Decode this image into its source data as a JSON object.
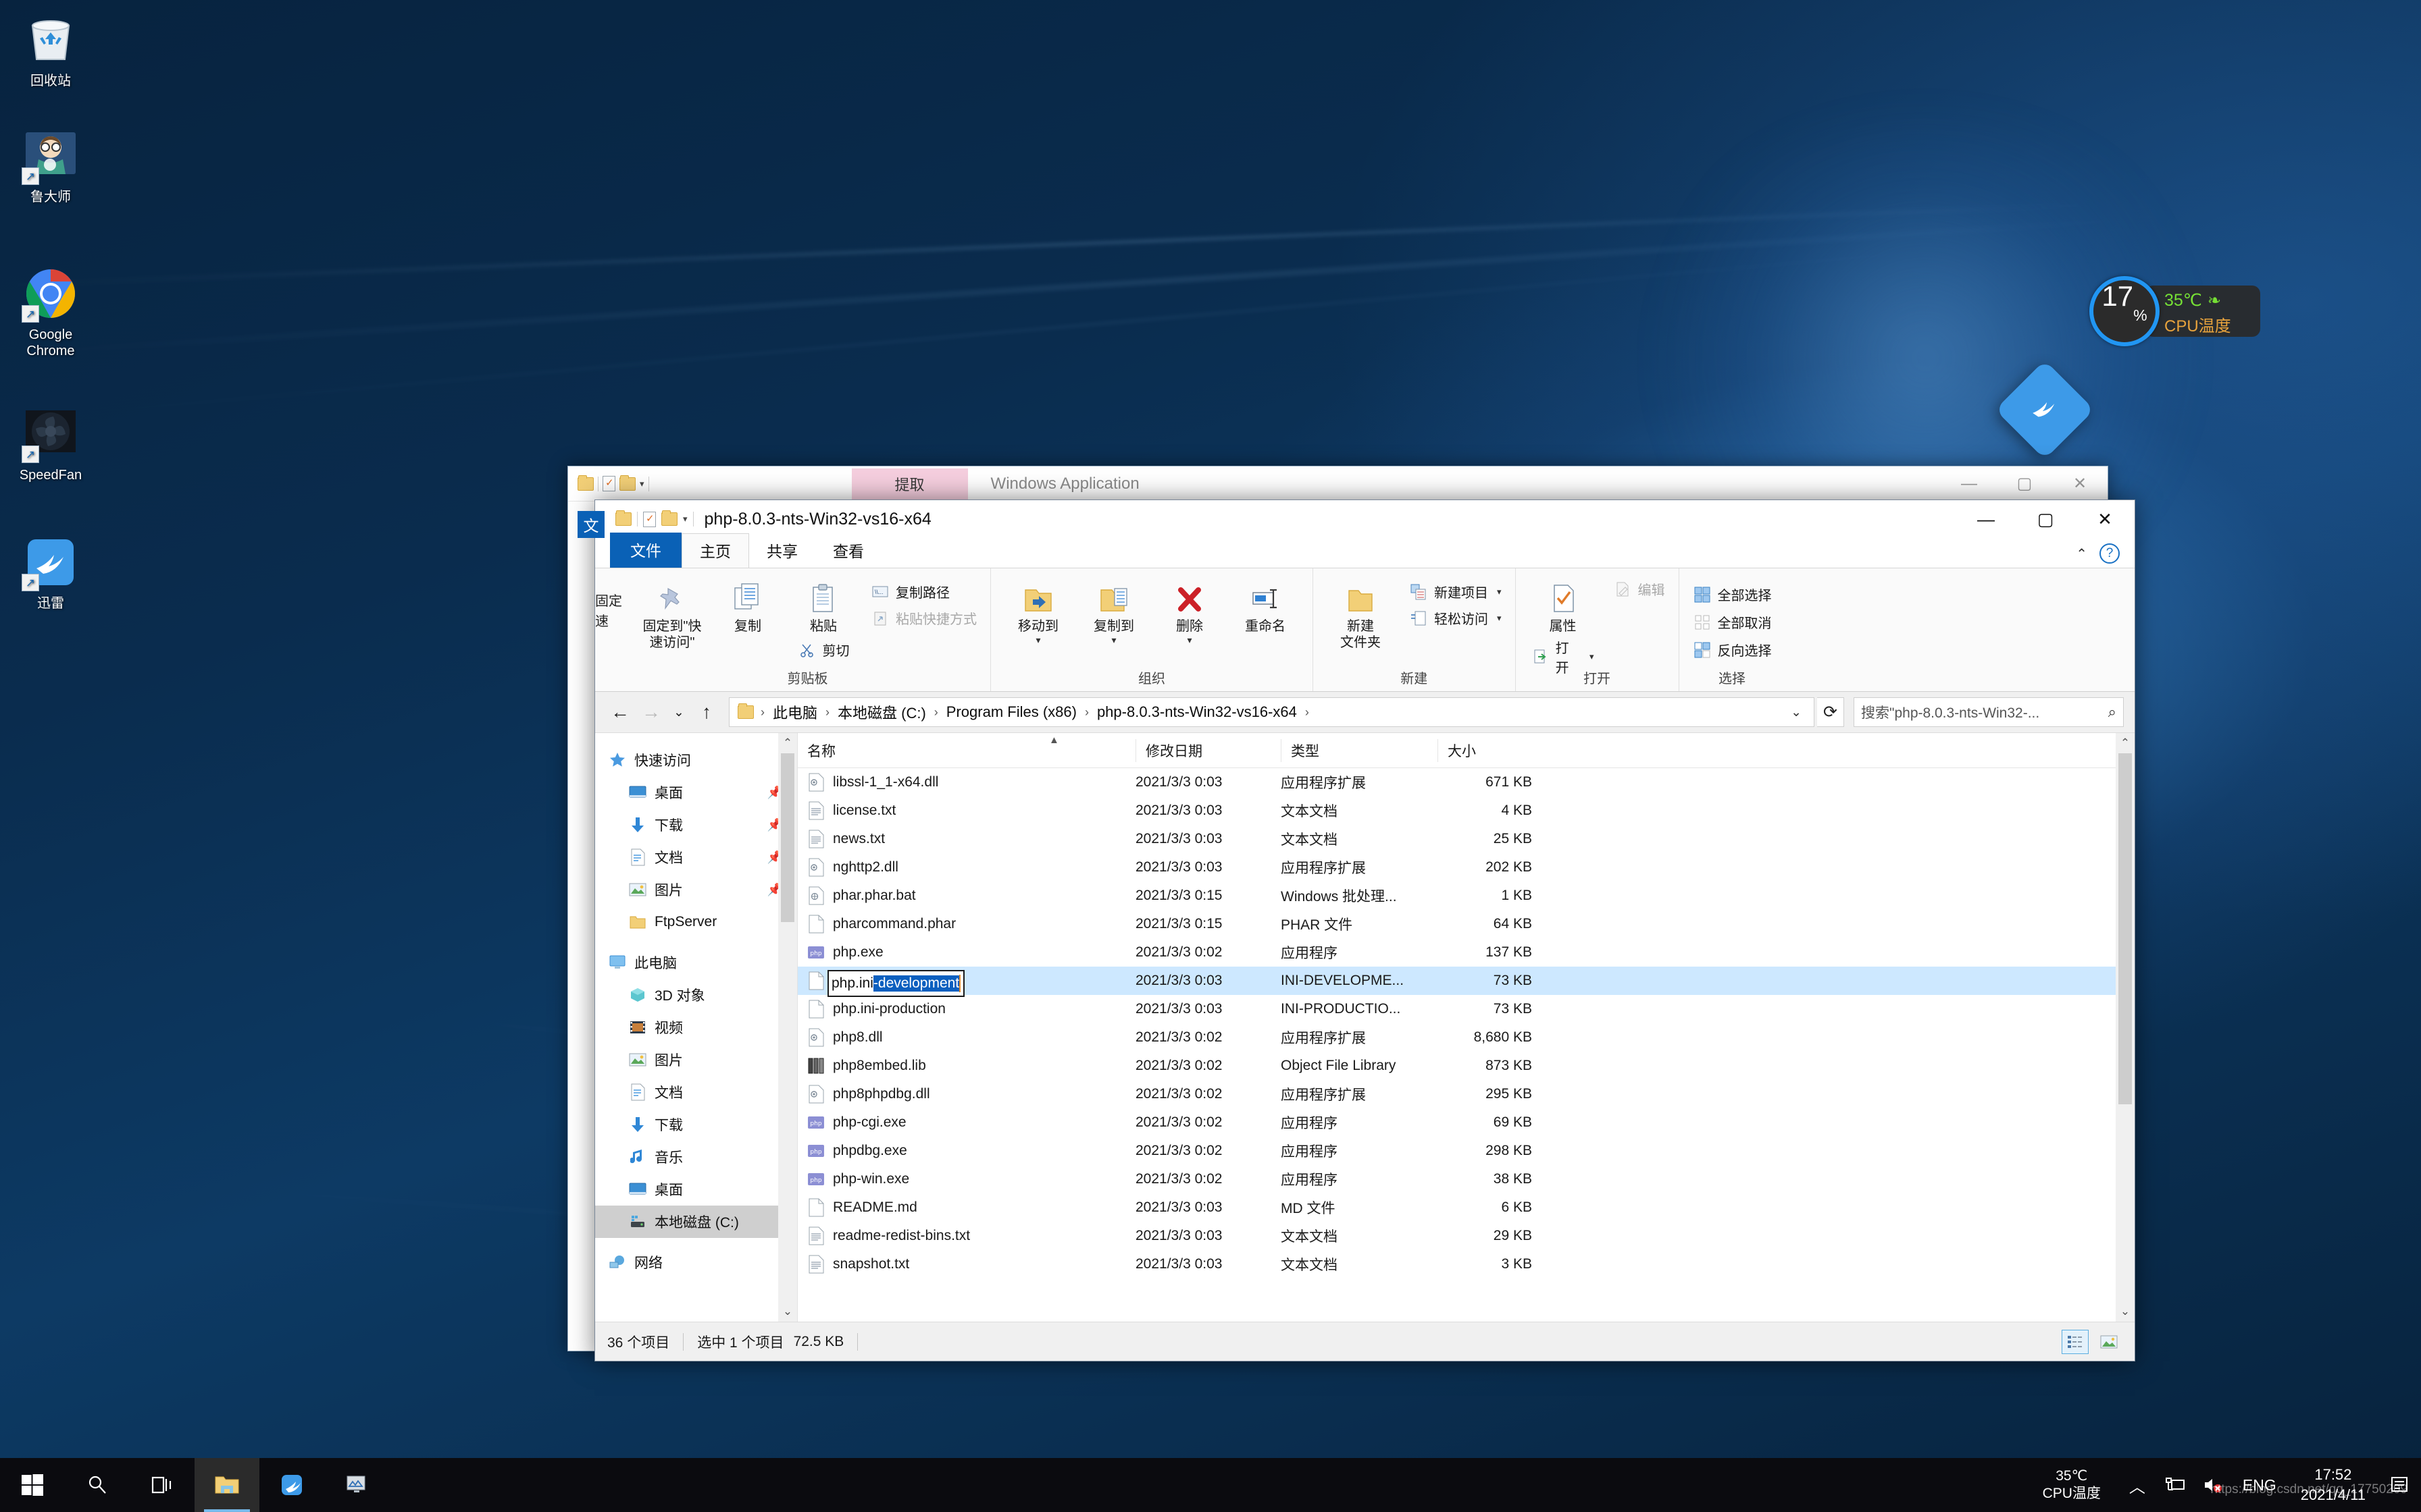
{
  "desktop": {
    "icons": [
      {
        "label": "回收站",
        "icon": "recycle-bin-icon",
        "shortcut": false
      },
      {
        "label": "鲁大师",
        "icon": "ludashi-icon",
        "shortcut": true
      },
      {
        "label": "Google\nChrome",
        "icon": "chrome-icon",
        "shortcut": true
      },
      {
        "label": "SpeedFan",
        "icon": "speedfan-icon",
        "shortcut": true
      },
      {
        "label": "迅雷",
        "icon": "xunlei-icon",
        "shortcut": true
      }
    ]
  },
  "cpu_widget": {
    "usage": "17",
    "usage_unit": "%",
    "temperature": "35℃",
    "temperature_label": "CPU温度",
    "leaf_icon": "leaf-icon"
  },
  "background_window": {
    "extract_button": "提取",
    "title": "Windows Application",
    "minimize": "—",
    "maximize": "▢",
    "close": "✕"
  },
  "explorer": {
    "titlebar": {
      "path_title": "php-8.0.3-nts-Win32-vs16-x64",
      "lang_badge": "文",
      "minimize": "—",
      "maximize": "▢",
      "close": "✕"
    },
    "tabs": [
      {
        "label": "文件",
        "name": "tab-file",
        "active_blue": true
      },
      {
        "label": "主页",
        "name": "tab-home",
        "selected": true
      },
      {
        "label": "共享",
        "name": "tab-share"
      },
      {
        "label": "查看",
        "name": "tab-view"
      }
    ],
    "ribbon": {
      "left_cut_label": "固定\n速",
      "groups": [
        {
          "name": "clipboard",
          "label": "剪贴板",
          "big": [
            {
              "label": "固定到\"快\n速访问\"",
              "icon": "pin-icon"
            },
            {
              "label": "复制",
              "icon": "copy-icon"
            },
            {
              "label": "粘贴",
              "icon": "paste-icon"
            }
          ],
          "small_under_paste": {
            "label": "剪切",
            "icon": "scissors-icon"
          },
          "small": [
            {
              "label": "复制路径",
              "icon": "copy-path-icon"
            },
            {
              "label": "粘贴快捷方式",
              "icon": "paste-shortcut-icon",
              "dim": true
            }
          ]
        },
        {
          "name": "organize",
          "label": "组织",
          "big": [
            {
              "label": "移动到",
              "icon": "move-to-icon",
              "caret": "▾"
            },
            {
              "label": "复制到",
              "icon": "copy-to-icon",
              "caret": "▾"
            },
            {
              "label": "删除",
              "icon": "delete-icon",
              "caret": "▾"
            },
            {
              "label": "重命名",
              "icon": "rename-icon"
            }
          ]
        },
        {
          "name": "new",
          "label": "新建",
          "big": [
            {
              "label": "新建\n文件夹",
              "icon": "new-folder-icon"
            }
          ],
          "small": [
            {
              "label": "新建项目",
              "icon": "new-item-icon",
              "caret": "▾"
            },
            {
              "label": "轻松访问",
              "icon": "easy-access-icon",
              "caret": "▾"
            }
          ]
        },
        {
          "name": "open",
          "label": "打开",
          "big": [
            {
              "label": "属性",
              "icon": "properties-icon"
            }
          ],
          "small": [
            {
              "label": "打开",
              "icon": "open-icon",
              "caret": "▾"
            },
            {
              "label": "编辑",
              "icon": "edit-icon",
              "dim": true
            }
          ]
        },
        {
          "name": "select",
          "label": "选择",
          "small": [
            {
              "label": "全部选择",
              "icon": "select-all-icon"
            },
            {
              "label": "全部取消",
              "icon": "select-none-icon"
            },
            {
              "label": "反向选择",
              "icon": "invert-selection-icon"
            }
          ]
        }
      ]
    },
    "address": {
      "back_icon": "back-arrow-icon",
      "forward_icon": "forward-arrow-icon",
      "recent_icon": "chevron-down-icon",
      "up_icon": "up-arrow-icon",
      "breadcrumbs": [
        "此电脑",
        "本地磁盘 (C:)",
        "Program Files (x86)",
        "php-8.0.3-nts-Win32-vs16-x64"
      ],
      "separator": "›",
      "dropdown_icon": "chevron-down-icon",
      "refresh_icon": "refresh-icon",
      "search_placeholder": "搜索\"php-8.0.3-nts-Win32-...",
      "search_icon": "search-icon"
    },
    "navpane": [
      {
        "label": "快速访问",
        "icon": "star-icon",
        "indent": false
      },
      {
        "label": "桌面",
        "icon": "desktop-icon",
        "indent": true,
        "pin": "📌"
      },
      {
        "label": "下载",
        "icon": "download-icon",
        "indent": true,
        "pin": "📌"
      },
      {
        "label": "文档",
        "icon": "documents-icon",
        "indent": true,
        "pin": "📌"
      },
      {
        "label": "图片",
        "icon": "pictures-icon",
        "indent": true,
        "pin": "📌"
      },
      {
        "label": "FtpServer",
        "icon": "folder-icon",
        "indent": true
      },
      {
        "label": "此电脑",
        "icon": "this-pc-icon",
        "indent": false
      },
      {
        "label": "3D 对象",
        "icon": "3d-objects-icon",
        "indent": true
      },
      {
        "label": "视频",
        "icon": "videos-icon",
        "indent": true
      },
      {
        "label": "图片",
        "icon": "pictures-icon",
        "indent": true
      },
      {
        "label": "文档",
        "icon": "documents-icon",
        "indent": true
      },
      {
        "label": "下载",
        "icon": "download-icon",
        "indent": true
      },
      {
        "label": "音乐",
        "icon": "music-icon",
        "indent": true
      },
      {
        "label": "桌面",
        "icon": "desktop-icon",
        "indent": true
      },
      {
        "label": "本地磁盘 (C:)",
        "icon": "drive-icon",
        "indent": true,
        "selected": true
      },
      {
        "label": "网络",
        "icon": "network-icon",
        "indent": false
      }
    ],
    "columns": [
      {
        "label": "名称",
        "name": "column-name"
      },
      {
        "label": "修改日期",
        "name": "column-date"
      },
      {
        "label": "类型",
        "name": "column-type"
      },
      {
        "label": "大小",
        "name": "column-size"
      }
    ],
    "files": [
      {
        "name": "libssl-1_1-x64.dll",
        "date": "2021/3/3 0:03",
        "type": "应用程序扩展",
        "size": "671 KB",
        "icon": "dll-icon"
      },
      {
        "name": "license.txt",
        "date": "2021/3/3 0:03",
        "type": "文本文档",
        "size": "4 KB",
        "icon": "txt-icon"
      },
      {
        "name": "news.txt",
        "date": "2021/3/3 0:03",
        "type": "文本文档",
        "size": "25 KB",
        "icon": "txt-icon"
      },
      {
        "name": "nghttp2.dll",
        "date": "2021/3/3 0:03",
        "type": "应用程序扩展",
        "size": "202 KB",
        "icon": "dll-icon"
      },
      {
        "name": "phar.phar.bat",
        "date": "2021/3/3 0:15",
        "type": "Windows 批处理...",
        "size": "1 KB",
        "icon": "bat-icon"
      },
      {
        "name": "pharcommand.phar",
        "date": "2021/3/3 0:15",
        "type": "PHAR 文件",
        "size": "64 KB",
        "icon": "generic-file-icon"
      },
      {
        "name": "php.exe",
        "date": "2021/3/3 0:02",
        "type": "应用程序",
        "size": "137 KB",
        "icon": "php-exe-icon"
      },
      {
        "name": "php.ini-development",
        "date": "2021/3/3 0:03",
        "type": "INI-DEVELOPME...",
        "size": "73 KB",
        "icon": "generic-file-icon",
        "selected": true,
        "renaming": true
      },
      {
        "name": "php.ini-production",
        "date": "2021/3/3 0:03",
        "type": "INI-PRODUCTIO...",
        "size": "73 KB",
        "icon": "generic-file-icon"
      },
      {
        "name": "php8.dll",
        "date": "2021/3/3 0:02",
        "type": "应用程序扩展",
        "size": "8,680 KB",
        "icon": "dll-icon"
      },
      {
        "name": "php8embed.lib",
        "date": "2021/3/3 0:02",
        "type": "Object File Library",
        "size": "873 KB",
        "icon": "lib-icon"
      },
      {
        "name": "php8phpdbg.dll",
        "date": "2021/3/3 0:02",
        "type": "应用程序扩展",
        "size": "295 KB",
        "icon": "dll-icon"
      },
      {
        "name": "php-cgi.exe",
        "date": "2021/3/3 0:02",
        "type": "应用程序",
        "size": "69 KB",
        "icon": "php-exe-icon"
      },
      {
        "name": "phpdbg.exe",
        "date": "2021/3/3 0:02",
        "type": "应用程序",
        "size": "298 KB",
        "icon": "php-exe-icon"
      },
      {
        "name": "php-win.exe",
        "date": "2021/3/3 0:02",
        "type": "应用程序",
        "size": "38 KB",
        "icon": "php-exe-icon"
      },
      {
        "name": "README.md",
        "date": "2021/3/3 0:03",
        "type": "MD 文件",
        "size": "6 KB",
        "icon": "generic-file-icon"
      },
      {
        "name": "readme-redist-bins.txt",
        "date": "2021/3/3 0:03",
        "type": "文本文档",
        "size": "29 KB",
        "icon": "txt-icon"
      },
      {
        "name": "snapshot.txt",
        "date": "2021/3/3 0:03",
        "type": "文本文档",
        "size": "3 KB",
        "icon": "txt-icon"
      }
    ],
    "rename_edit": {
      "prefix": "php.ini",
      "selected_text": "-development"
    },
    "status": {
      "item_count": "36 个项目",
      "selection": "选中 1 个项目",
      "selection_size": "72.5 KB",
      "view_details_icon": "details-view-icon",
      "view_thumbnails_icon": "thumbnails-view-icon"
    }
  },
  "taskbar": {
    "start_icon": "windows-start-icon",
    "search_icon": "search-icon",
    "taskview_icon": "task-view-icon",
    "apps": [
      {
        "icon": "file-explorer-icon",
        "name": "taskbar-file-explorer",
        "active": true
      },
      {
        "icon": "xunlei-icon",
        "name": "taskbar-xunlei",
        "active": false
      },
      {
        "icon": "speedfan-icon",
        "name": "taskbar-speedfan",
        "active": false
      }
    ],
    "temp": "35℃",
    "temp_label": "CPU温度",
    "tray_chevron": "︿",
    "network_icon": "network-icon",
    "volume_icon": "volume-muted-icon",
    "language": "ENG",
    "time": "17:52",
    "date": "2021/4/11",
    "notification_icon": "notification-icon",
    "watermark": "https://blog.csdn.net/qq_17750209"
  }
}
